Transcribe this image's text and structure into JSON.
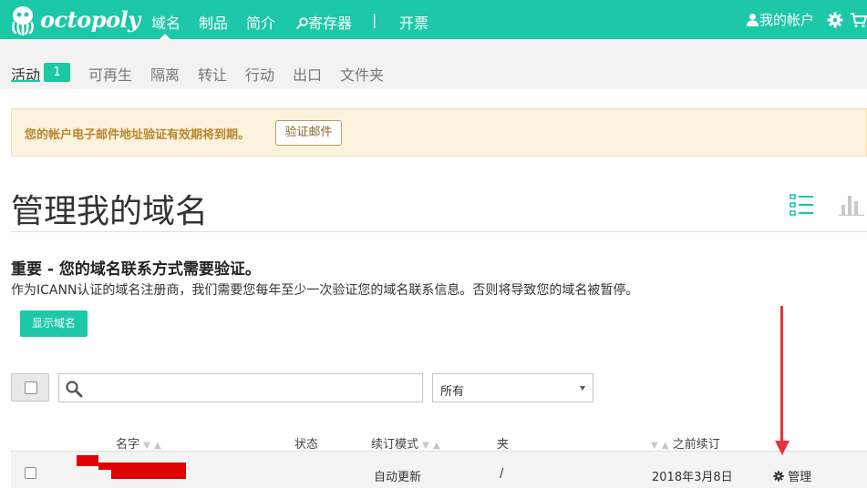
{
  "brand": {
    "name": "octopoly"
  },
  "topnav": {
    "items": [
      {
        "label": "域名"
      },
      {
        "label": "制品"
      },
      {
        "label": "简介"
      },
      {
        "label": "寄存器"
      },
      {
        "label": "|"
      },
      {
        "label": "开票"
      }
    ],
    "account_label": "我的帐户"
  },
  "subnav": {
    "tabs": [
      {
        "label": "活动"
      },
      {
        "label": "可再生"
      },
      {
        "label": "隔离"
      },
      {
        "label": "转让"
      },
      {
        "label": "行动"
      },
      {
        "label": "出口"
      },
      {
        "label": "文件夹"
      }
    ],
    "active_count": "1"
  },
  "alert": {
    "message": "您的帐户电子邮件地址验证有效期将到期。",
    "button_label": "验证邮件"
  },
  "page": {
    "title": "管理我的域名"
  },
  "notice": {
    "heading": "重要 - 您的域名联系方式需要验证。",
    "description": "作为ICANN认证的域名注册商，我们需要您每年至少一次验证您的域名联系信息。否则将导致您的域名被暂停。",
    "button_label": "显示域名"
  },
  "toolbar": {
    "search_value": "",
    "filter_value": "所有"
  },
  "table": {
    "columns": {
      "name": "名字",
      "status": "状态",
      "renew_mode": "续订模式",
      "folder": "夹",
      "previous_renew": "之前续订"
    },
    "sort_up": "▼",
    "sort_down": "▲",
    "rows": [
      {
        "status": "",
        "renew_mode": "自动更新",
        "folder": "/",
        "previous_renew": "2018年3月8日",
        "action": "管理"
      }
    ]
  },
  "colors": {
    "brand_teal": "#1cc8a8",
    "alert_bg": "#fcf3de",
    "annotation_red": "#e8333a"
  }
}
